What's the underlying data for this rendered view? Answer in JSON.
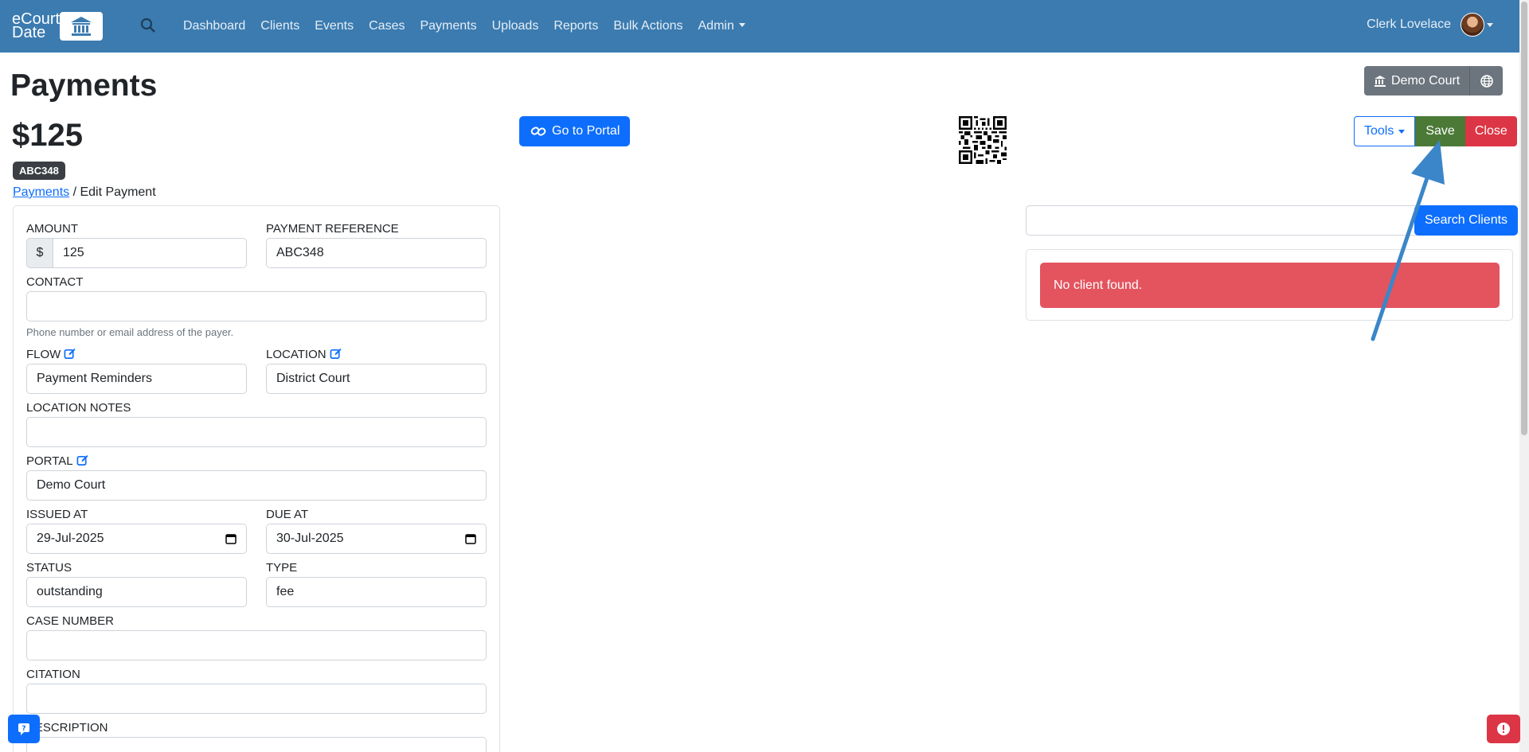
{
  "navbar": {
    "brand_line1": "eCourt",
    "brand_line2": "Date",
    "links": [
      "Dashboard",
      "Clients",
      "Events",
      "Cases",
      "Payments",
      "Uploads",
      "Reports",
      "Bulk Actions",
      "Admin"
    ],
    "user_name": "Clerk Lovelace"
  },
  "header": {
    "title": "Payments",
    "court_button": "Demo Court",
    "amount": "$125",
    "reference_badge": "ABC348",
    "breadcrumb_link": "Payments",
    "breadcrumb_current": "/ Edit Payment",
    "portal_button": "Go to Portal",
    "tools_button": "Tools",
    "save_button": "Save",
    "close_button": "Close"
  },
  "form": {
    "amount_label": "AMOUNT",
    "amount_prefix": "$",
    "amount_value": "125",
    "reference_label": "PAYMENT REFERENCE",
    "reference_value": "ABC348",
    "contact_label": "CONTACT",
    "contact_value": "",
    "contact_help": "Phone number or email address of the payer.",
    "flow_label": "FLOW",
    "flow_value": "Payment Reminders",
    "location_label": "LOCATION",
    "location_value": "District Court",
    "location_notes_label": "LOCATION NOTES",
    "location_notes_value": "",
    "portal_label": "PORTAL",
    "portal_value": "Demo Court",
    "issued_label": "ISSUED AT",
    "issued_value": "29-Jul-2025",
    "due_label": "DUE AT",
    "due_value": "30-Jul-2025",
    "status_label": "STATUS",
    "status_value": "outstanding",
    "type_label": "TYPE",
    "type_value": "fee",
    "case_label": "CASE NUMBER",
    "case_value": "",
    "citation_label": "CITATION",
    "citation_value": "",
    "description_label": "DESCRIPTION"
  },
  "clients": {
    "search_button": "Search Clients",
    "search_value": "",
    "empty_message": "No client found."
  },
  "colors": {
    "navbar": "#3b7bb0",
    "primary": "#0d6efd",
    "save": "#4b7a37",
    "danger": "#dc3545",
    "alert": "#e3545f",
    "arrow": "#3a86c8"
  }
}
